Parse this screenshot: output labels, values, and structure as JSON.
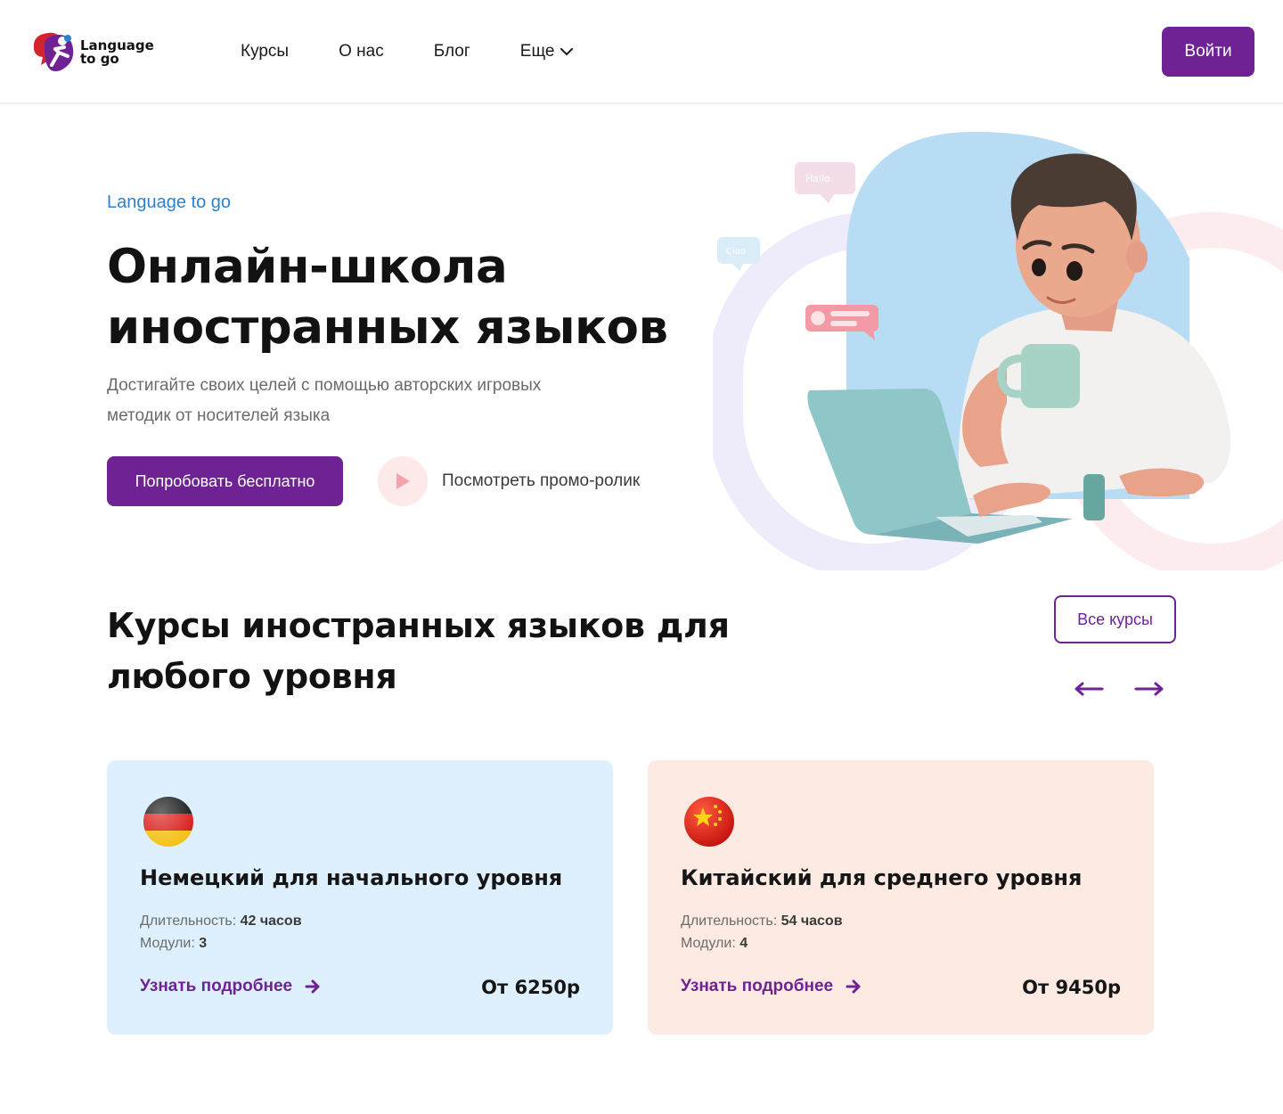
{
  "header": {
    "logo_line1": "Language",
    "logo_line2": "to go",
    "nav": [
      {
        "label": "Курсы"
      },
      {
        "label": "О нас"
      },
      {
        "label": "Блог"
      },
      {
        "label": "Еще"
      }
    ],
    "login_label": "Войти"
  },
  "hero": {
    "eyebrow": "Language to go",
    "title_line1": "Онлайн-школа",
    "title_line2": "иностранных языков",
    "subtitle": "Достигайте своих целей с помощью авторских игровых методик от носителей языка",
    "try_label": "Попробовать бесплатно",
    "promo_label": "Посмотреть промо-ролик",
    "bubble_hallo": "Hallo",
    "bubble_ciao": "Ciao"
  },
  "courses": {
    "title_line1": "Курсы иностранных языков для",
    "title_line2": "любого уровня",
    "all_label": "Все курсы",
    "items": [
      {
        "flag_icon": "germany-flag-icon",
        "title": "Немецкий для начального уровня",
        "duration_label": "Длительность:",
        "duration_value": "42 часов",
        "modules_label": "Модули:",
        "modules_value": "3",
        "more_label": "Узнать подробнее",
        "price": "От 6250р"
      },
      {
        "flag_icon": "china-flag-icon",
        "title": "Китайский для среднего уровня",
        "duration_label": "Длительность:",
        "duration_value": "54 часов",
        "modules_label": "Модули:",
        "modules_value": "4",
        "more_label": "Узнать подробнее",
        "price": "От 9450р"
      }
    ]
  },
  "colors": {
    "accent": "#6f2294",
    "eyebrow": "#2b82cf",
    "card_blue": "#def0fd",
    "card_peach": "#fdebe3"
  }
}
